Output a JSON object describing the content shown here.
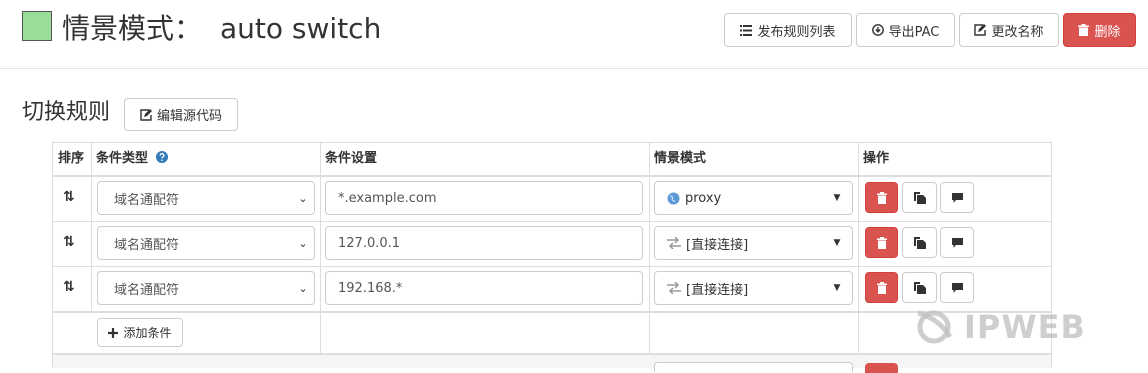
{
  "header": {
    "title_prefix": "情景模式：",
    "profile_name": "auto switch",
    "buttons": {
      "publish": "发布规则列表",
      "export_pac": "导出PAC",
      "rename": "更改名称",
      "delete": "删除"
    }
  },
  "section": {
    "title": "切换规则",
    "edit_source": "编辑源代码"
  },
  "table": {
    "headers": {
      "sort": "排序",
      "condition_type": "条件类型",
      "condition_settings": "条件设置",
      "profile": "情景模式",
      "actions": "操作"
    },
    "rows": [
      {
        "condition_type": "域名通配符",
        "condition_value": "*.example.com",
        "profile": "proxy",
        "profile_icon": "globe-icon"
      },
      {
        "condition_type": "域名通配符",
        "condition_value": "127.0.0.1",
        "profile": "[直接连接]",
        "profile_icon": "transfer-icon"
      },
      {
        "condition_type": "域名通配符",
        "condition_value": "192.168.*",
        "profile": "[直接连接]",
        "profile_icon": "transfer-icon"
      }
    ],
    "add_condition": "添加条件"
  },
  "watermark": "IPWEB",
  "colors": {
    "swatch": "#99dd99",
    "danger": "#d9534f",
    "help_icon": "#337ab7",
    "globe_icon": "#5b9bd5"
  }
}
